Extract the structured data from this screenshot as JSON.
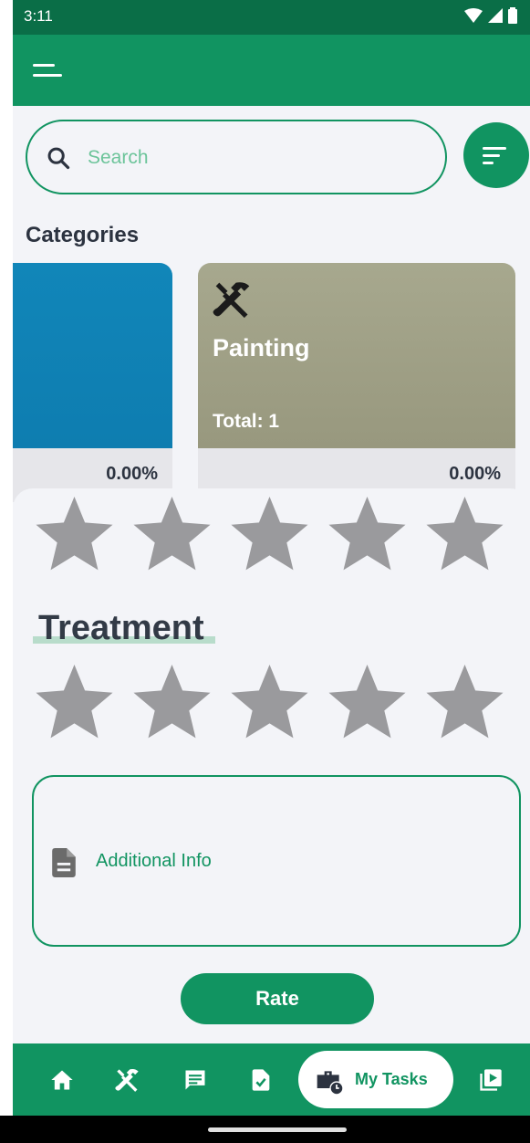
{
  "status_bar": {
    "time": "3:11"
  },
  "search": {
    "placeholder": "Search",
    "value": ""
  },
  "categories": {
    "title": "Categories",
    "items": [
      {
        "title": "",
        "total": "",
        "percent": "0.00%",
        "color": "#1186b9"
      },
      {
        "title": "Painting",
        "total": "Total: 1",
        "percent": "0.00%",
        "color": "#a7a88e",
        "icon": "tools-icon"
      }
    ]
  },
  "rating": {
    "first_row": {
      "stars": 5,
      "rating": 0
    },
    "treatment": {
      "label": "Treatment",
      "stars": 5,
      "rating": 0
    },
    "additional_info": {
      "placeholder": "Additional Info",
      "icon": "document-icon"
    },
    "submit_label": "Rate"
  },
  "bottom_nav": {
    "items": [
      {
        "icon": "home-icon"
      },
      {
        "icon": "tools-icon"
      },
      {
        "icon": "chat-icon"
      },
      {
        "icon": "task-check-icon"
      },
      {
        "icon": "briefcase-clock-icon",
        "label": "My Tasks",
        "active": true
      },
      {
        "icon": "video-library-icon"
      }
    ]
  },
  "colors": {
    "primary": "#119461",
    "status_bar": "#0a6e47",
    "star": "#9a9a9d",
    "text_dark": "#2c3340"
  }
}
